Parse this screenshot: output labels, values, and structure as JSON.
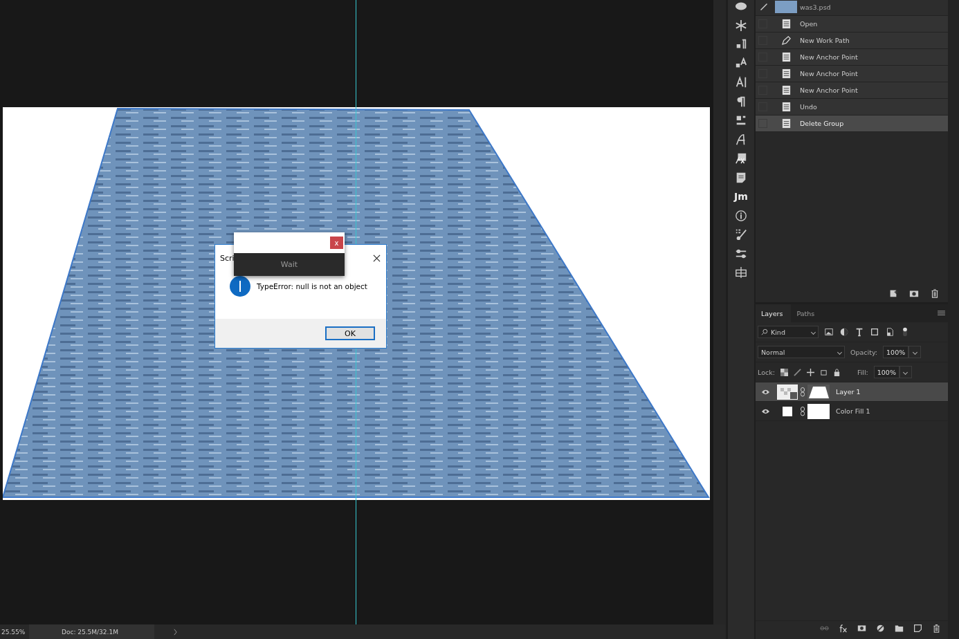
{
  "dialog": {
    "title": "Scri",
    "message": "TypeError: null is not an object",
    "button": "OK"
  },
  "wait_popup": {
    "label": "Wait",
    "close": "x"
  },
  "status_bar": {
    "zoom": "25.55%",
    "doc": "Doc: 25.5M/32.1M"
  },
  "tool_strip": {
    "text_icon": "Jm"
  },
  "history": {
    "document": "was3.psd",
    "steps": [
      {
        "label": "Open",
        "kind": "document",
        "selected": false
      },
      {
        "label": "New Work Path",
        "kind": "pen",
        "selected": false
      },
      {
        "label": "New Anchor Point",
        "kind": "document",
        "selected": false
      },
      {
        "label": "New Anchor Point",
        "kind": "document",
        "selected": false
      },
      {
        "label": "New Anchor Point",
        "kind": "document",
        "selected": false
      },
      {
        "label": "Undo",
        "kind": "document",
        "selected": false
      },
      {
        "label": "Delete Group",
        "kind": "document",
        "selected": true
      }
    ]
  },
  "layers_panel": {
    "tabs": [
      {
        "label": "Layers",
        "selected": true
      },
      {
        "label": "Paths",
        "selected": false
      }
    ],
    "filter": "Kind",
    "blend_mode": "Normal",
    "opacity_label": "Opacity:",
    "opacity": "100%",
    "lock_label": "Lock:",
    "fill_label": "Fill:",
    "fill": "100%",
    "layers": [
      {
        "name": "Layer 1",
        "kind": "smart",
        "visible": true,
        "selected": true
      },
      {
        "name": "Color Fill 1",
        "kind": "fill",
        "visible": true,
        "selected": false
      }
    ]
  }
}
